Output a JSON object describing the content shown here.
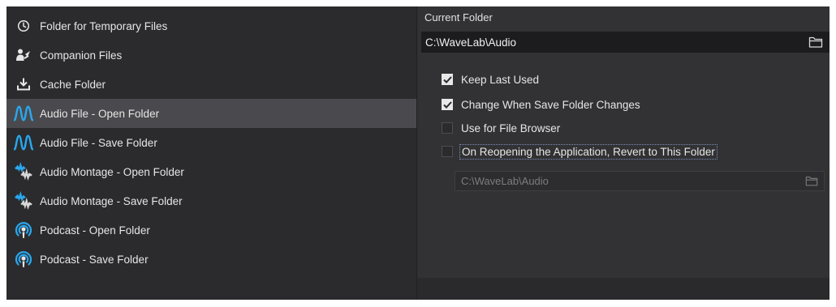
{
  "sidebar": {
    "items": [
      {
        "label": "Folder for Temporary Files",
        "icon": "clock-icon"
      },
      {
        "label": "Companion Files",
        "icon": "companion-files-icon"
      },
      {
        "label": "Cache Folder",
        "icon": "download-icon"
      },
      {
        "label": "Audio File - Open Folder",
        "icon": "audio-wave-icon"
      },
      {
        "label": "Audio File - Save Folder",
        "icon": "audio-wave-icon"
      },
      {
        "label": "Audio Montage - Open Folder",
        "icon": "audio-montage-icon"
      },
      {
        "label": "Audio Montage - Save Folder",
        "icon": "audio-montage-icon"
      },
      {
        "label": "Podcast - Open Folder",
        "icon": "podcast-icon"
      },
      {
        "label": "Podcast - Save Folder",
        "icon": "podcast-icon"
      }
    ],
    "selected_index": 3
  },
  "panel": {
    "current_folder_label": "Current Folder",
    "current_folder_path": "C:\\WaveLab\\Audio",
    "options": [
      {
        "label": "Keep Last Used",
        "checked": true
      },
      {
        "label": "Change When Save Folder Changes",
        "checked": true
      },
      {
        "label": "Use for File Browser",
        "checked": false
      },
      {
        "label": "On Reopening the Application, Revert to This Folder",
        "checked": false
      }
    ],
    "revert_folder_path": "C:\\WaveLab\\Audio"
  },
  "colors": {
    "accent_blue": "#29a8f0",
    "panel_bg": "#323234",
    "list_bg": "#2b2b2d",
    "selected_bg": "#4a4a4e"
  }
}
